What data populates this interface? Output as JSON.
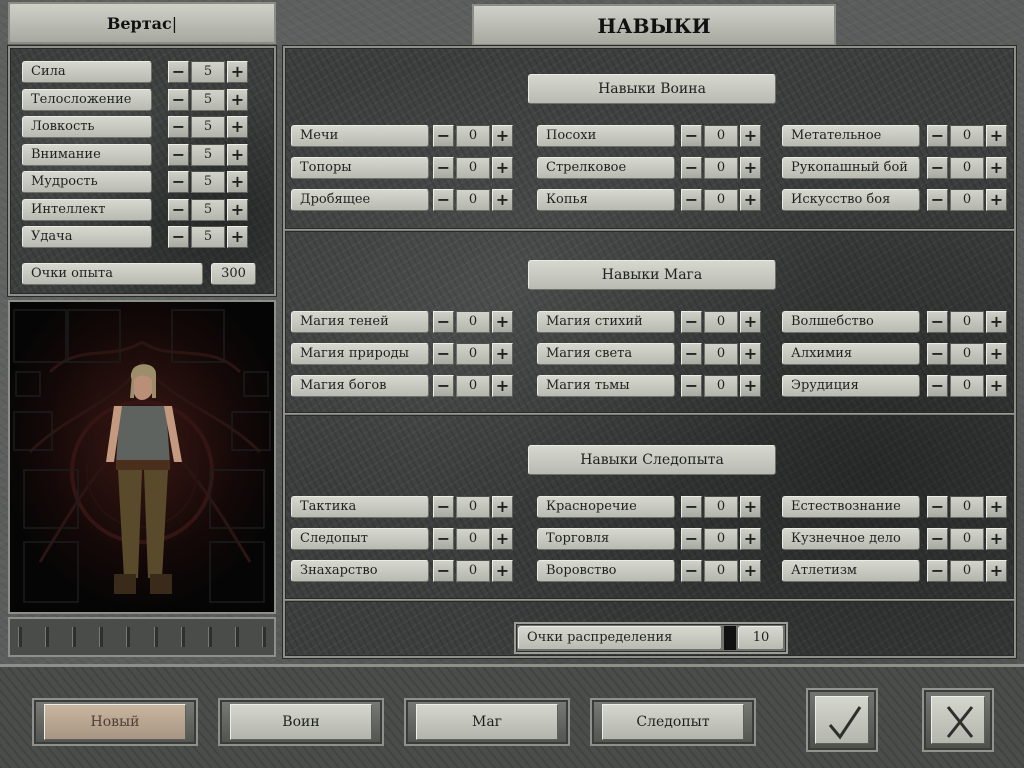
{
  "character": {
    "name": "Вертас"
  },
  "page_title": "НАВЫКИ",
  "attributes": [
    {
      "label": "Сила",
      "value": "5"
    },
    {
      "label": "Телосложение",
      "value": "5"
    },
    {
      "label": "Ловкость",
      "value": "5"
    },
    {
      "label": "Внимание",
      "value": "5"
    },
    {
      "label": "Мудрость",
      "value": "5"
    },
    {
      "label": "Интеллект",
      "value": "5"
    },
    {
      "label": "Удача",
      "value": "5"
    }
  ],
  "experience": {
    "label": "Очки опыта",
    "value": "300"
  },
  "stepper": {
    "minus": "−",
    "plus": "+"
  },
  "sections": [
    {
      "title": "Навыки Воина",
      "skills": [
        {
          "label": "Мечи",
          "value": "0"
        },
        {
          "label": "Посохи",
          "value": "0"
        },
        {
          "label": "Метательное",
          "value": "0"
        },
        {
          "label": "Топоры",
          "value": "0"
        },
        {
          "label": "Стрелковое",
          "value": "0"
        },
        {
          "label": "Рукопашный бой",
          "value": "0"
        },
        {
          "label": "Дробящее",
          "value": "0"
        },
        {
          "label": "Копья",
          "value": "0"
        },
        {
          "label": "Искусство боя",
          "value": "0"
        }
      ]
    },
    {
      "title": "Навыки Мага",
      "skills": [
        {
          "label": "Магия теней",
          "value": "0"
        },
        {
          "label": "Магия стихий",
          "value": "0"
        },
        {
          "label": "Волшебство",
          "value": "0"
        },
        {
          "label": "Магия природы",
          "value": "0"
        },
        {
          "label": "Магия света",
          "value": "0"
        },
        {
          "label": "Алхимия",
          "value": "0"
        },
        {
          "label": "Магия богов",
          "value": "0"
        },
        {
          "label": "Магия тьмы",
          "value": "0"
        },
        {
          "label": "Эрудиция",
          "value": "0"
        }
      ]
    },
    {
      "title": "Навыки Следопыта",
      "skills": [
        {
          "label": "Тактика",
          "value": "0"
        },
        {
          "label": "Красноречие",
          "value": "0"
        },
        {
          "label": "Естествознание",
          "value": "0"
        },
        {
          "label": "Следопыт",
          "value": "0"
        },
        {
          "label": "Торговля",
          "value": "0"
        },
        {
          "label": "Кузнечное дело",
          "value": "0"
        },
        {
          "label": "Знахарство",
          "value": "0"
        },
        {
          "label": "Воровство",
          "value": "0"
        },
        {
          "label": "Атлетизм",
          "value": "0"
        }
      ]
    }
  ],
  "distribution": {
    "label": "Очки распределения",
    "value": "10"
  },
  "bottom_buttons": [
    {
      "label": "Новый",
      "selected": true
    },
    {
      "label": "Воин",
      "selected": false
    },
    {
      "label": "Маг",
      "selected": false
    },
    {
      "label": "Следопыт",
      "selected": false
    }
  ],
  "icons": {
    "confirm": "checkmark-icon",
    "cancel": "cross-icon"
  }
}
